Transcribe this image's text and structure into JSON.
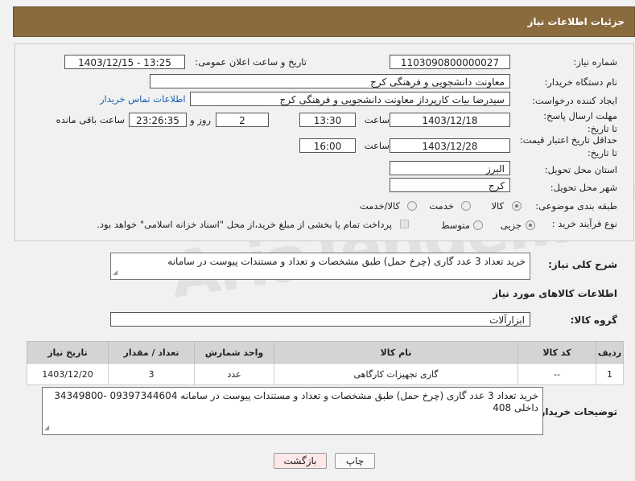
{
  "header": {
    "title": "جزئیات اطلاعات نیاز"
  },
  "fields": {
    "need_number_label": "شماره نیاز:",
    "need_number": "1103090800000027",
    "announce_label": "تاریخ و ساعت اعلان عمومی:",
    "announce_value": "1403/12/15 - 13:25",
    "buyer_org_label": "نام دستگاه خریدار:",
    "buyer_org": "معاونت دانشجویی و فرهنگی کرج",
    "requester_label": "ایجاد کننده درخواست:",
    "requester": "سیدرضا بیات کارپرداز معاونت دانشجویی و فرهنگی کرج",
    "contact_link": "اطلاعات تماس خریدار",
    "deadline_label": "مهلت ارسال پاسخ: تا تاریخ:",
    "deadline_date": "1403/12/18",
    "time_label": "ساعت",
    "deadline_time": "13:30",
    "days_value": "2",
    "days_label": "روز و",
    "remaining_value": "23:26:35",
    "remaining_label": "ساعت باقی مانده",
    "validity_label": "حداقل تاریخ اعتبار قیمت: تا تاریخ:",
    "validity_date": "1403/12/28",
    "validity_time": "16:00",
    "province_label": "استان محل تحویل:",
    "province": "البرز",
    "city_label": "شهر محل تحویل:",
    "city": "کرج",
    "category_label": "طبقه بندی موضوعی:",
    "category_options": [
      "کالا",
      "خدمت",
      "کالا/خدمت"
    ],
    "process_label": "نوع فرآیند خرید :",
    "process_options": [
      "جزیی",
      "متوسط"
    ],
    "payment_note": "پرداخت تمام یا بخشی از مبلغ خرید،از محل \"اسناد خزانه اسلامی\" خواهد بود."
  },
  "summary": {
    "label": "شرح کلی نیاز:",
    "text": "خرید تعداد 3 عدد گاری (چرخ حمل) طبق مشخصات و تعداد و مستندات پیوست در سامانه"
  },
  "goods_section": {
    "title": "اطلاعات کالاهای مورد نیاز",
    "group_label": "گروه کالا:",
    "group_value": "ابزارآلات"
  },
  "table": {
    "columns": [
      "ردیف",
      "کد کالا",
      "نام کالا",
      "واحد شمارش",
      "تعداد / مقدار",
      "تاریخ نیاز"
    ],
    "rows": [
      [
        "1",
        "--",
        "گاری تجهیزات کارگاهی",
        "عدد",
        "3",
        "1403/12/20"
      ]
    ]
  },
  "buyer_notes": {
    "label": "توضیحات خریدار:",
    "text": "خرید تعداد 3 عدد گاری (چرخ حمل) طبق مشخصات و تعداد و مستندات پیوست در سامانه 09397344604 -34349800 داخلی 408"
  },
  "buttons": {
    "print": "چاپ",
    "back": "بازگشت"
  },
  "watermark": "AriaTender.neT",
  "colors": {
    "header_bg": "#8a6b3e",
    "link": "#1a5fb4",
    "back_button_bg": "#fde8e8"
  }
}
